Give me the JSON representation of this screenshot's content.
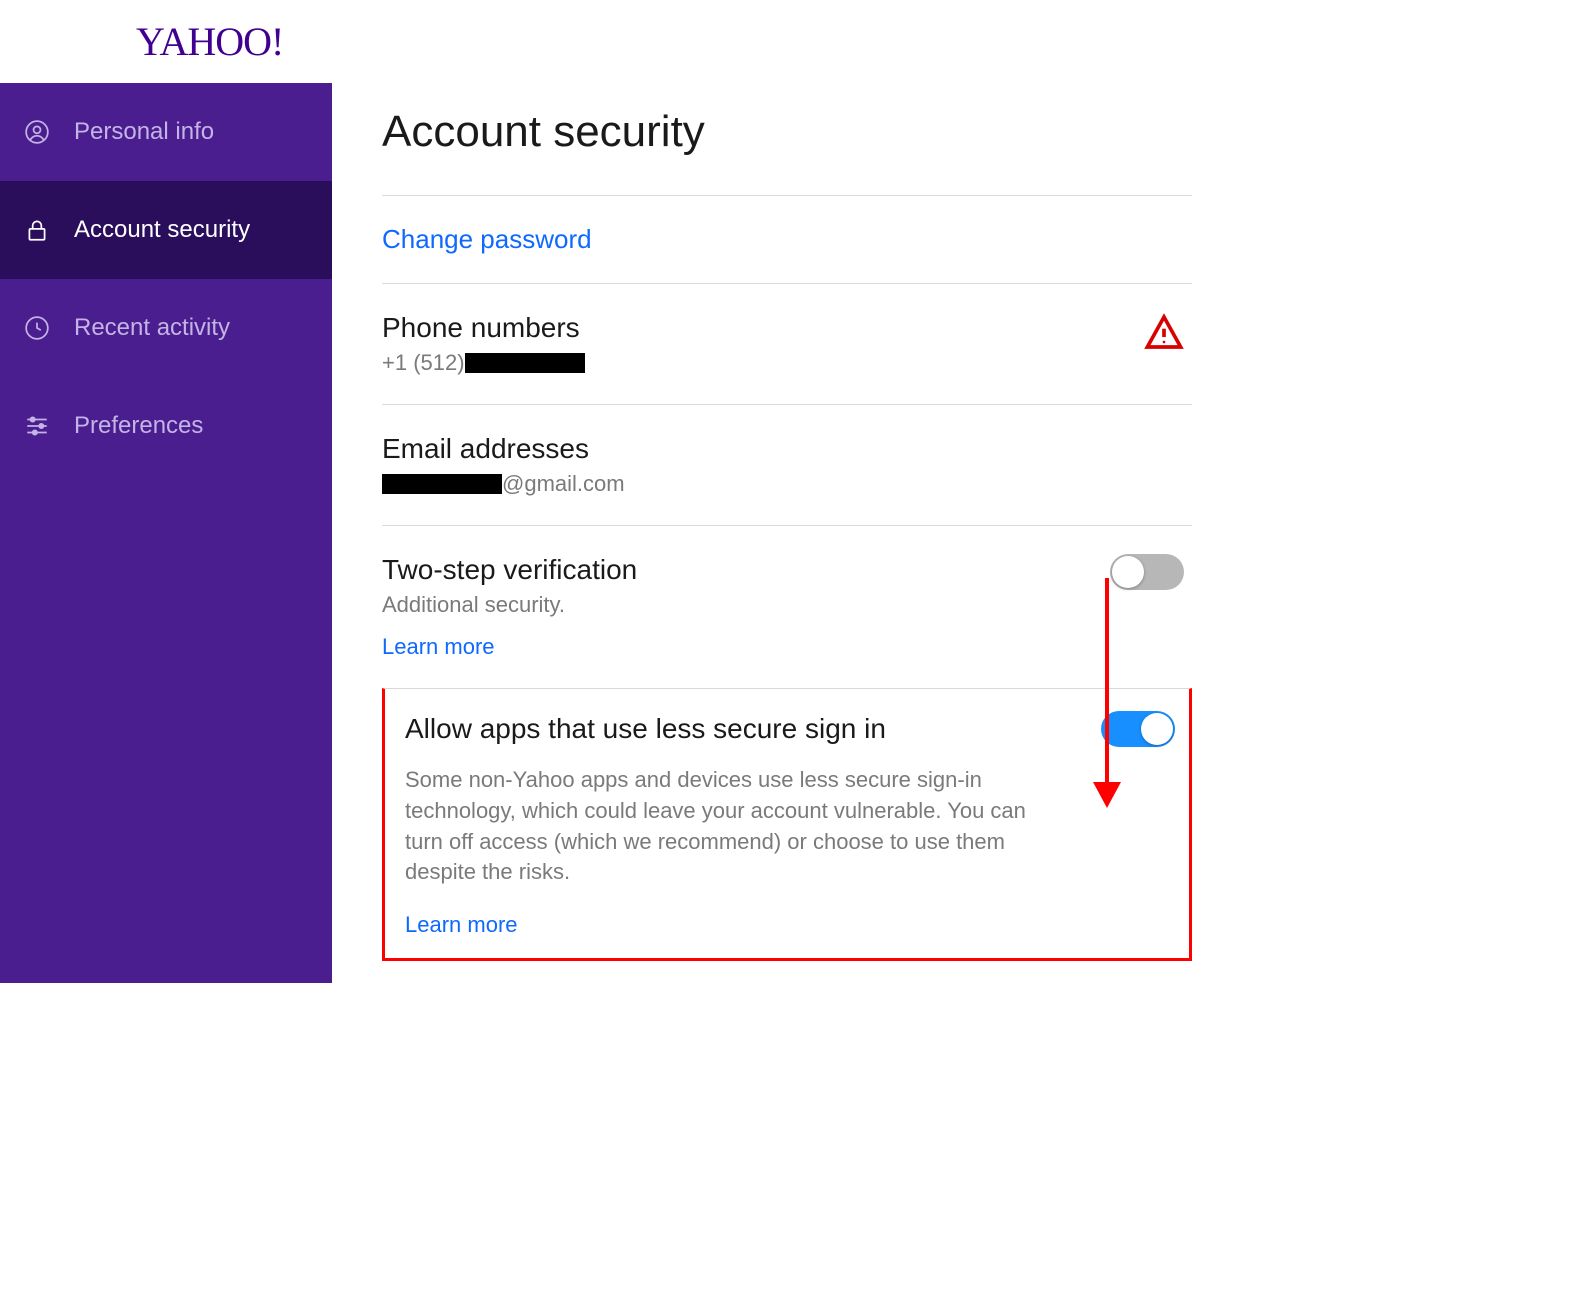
{
  "brand": {
    "logo_text": "YAHOO!"
  },
  "sidebar": {
    "items": [
      {
        "label": "Personal info"
      },
      {
        "label": "Account security"
      },
      {
        "label": "Recent activity"
      },
      {
        "label": "Preferences"
      }
    ],
    "active_index": 1
  },
  "main": {
    "title": "Account security",
    "change_password_link": "Change password",
    "phone": {
      "title": "Phone numbers",
      "prefix": "+1 (512)",
      "redacted_suffix": true
    },
    "email": {
      "title": "Email addresses",
      "redacted_prefix": true,
      "suffix": "@gmail.com"
    },
    "two_step": {
      "title": "Two-step verification",
      "subtitle": "Additional security.",
      "learn_more": "Learn more",
      "enabled": false
    },
    "less_secure": {
      "title": "Allow apps that use less secure sign in",
      "description": "Some non-Yahoo apps and devices use less secure sign-in technology, which could leave your account vulnerable. You can turn off access (which we recommend) or choose to use them despite the risks.",
      "learn_more": "Learn more",
      "enabled": true
    }
  }
}
